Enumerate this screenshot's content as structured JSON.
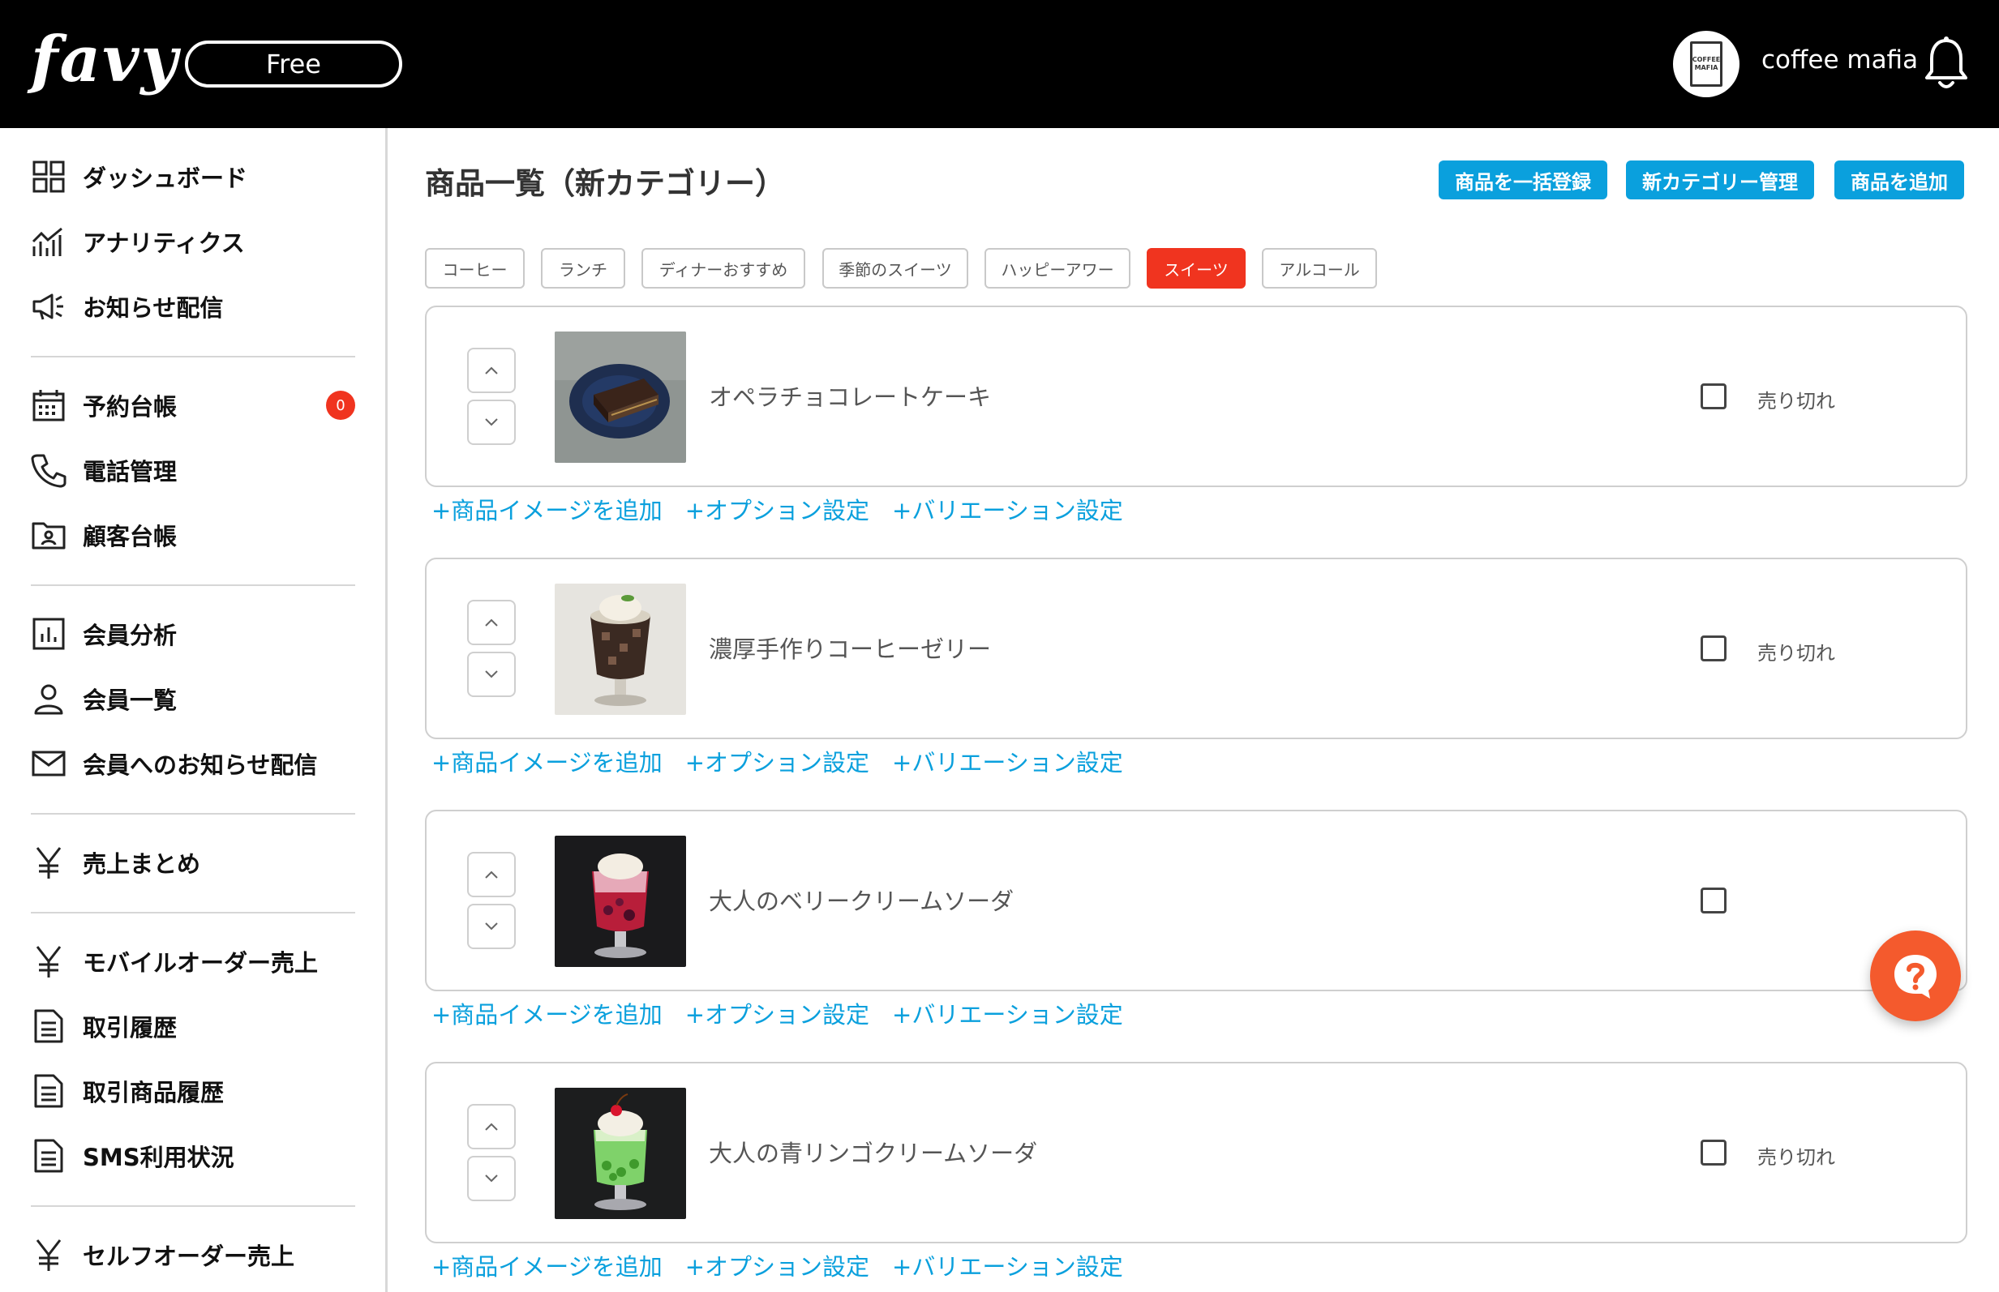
{
  "header": {
    "logo": "favy",
    "plan": "Free",
    "shop_avatar_text": "COFFEE MAFIA",
    "shop_name": "coffee mafia",
    "bell_icon": "bell-icon"
  },
  "sidebar": {
    "items": [
      {
        "label": "ダッシュボード",
        "icon": "dashboard-grid-icon"
      },
      {
        "label": "アナリティクス",
        "icon": "analytics-chart-icon"
      },
      {
        "label": "お知らせ配信",
        "icon": "megaphone-icon"
      },
      {
        "label": "予約台帳",
        "icon": "calendar-icon",
        "badge": "0"
      },
      {
        "label": "電話管理",
        "icon": "phone-icon"
      },
      {
        "label": "顧客台帳",
        "icon": "customer-folder-icon"
      },
      {
        "label": "会員分析",
        "icon": "bar-chart-icon"
      },
      {
        "label": "会員一覧",
        "icon": "user-icon"
      },
      {
        "label": "会員へのお知らせ配信",
        "icon": "mail-icon"
      },
      {
        "label": "売上まとめ",
        "icon": "yen-icon"
      },
      {
        "label": "モバイルオーダー売上",
        "icon": "yen-icon"
      },
      {
        "label": "取引履歴",
        "icon": "document-icon"
      },
      {
        "label": "取引商品履歴",
        "icon": "document-icon"
      },
      {
        "label": "SMS利用状況",
        "icon": "document-icon"
      },
      {
        "label": "セルフオーダー売上",
        "icon": "yen-icon"
      }
    ]
  },
  "main": {
    "title": "商品一覧（新カテゴリー）",
    "actions": {
      "bulk_register": "商品を一括登録",
      "category_manage": "新カテゴリー管理",
      "add_product": "商品を追加"
    },
    "categories": [
      {
        "label": "コーヒー",
        "active": false
      },
      {
        "label": "ランチ",
        "active": false
      },
      {
        "label": "ディナーおすすめ",
        "active": false
      },
      {
        "label": "季節のスイーツ",
        "active": false
      },
      {
        "label": "ハッピーアワー",
        "active": false
      },
      {
        "label": "スイーツ",
        "active": true
      },
      {
        "label": "アルコール",
        "active": false
      }
    ],
    "products": [
      {
        "name": "オペラチョコレートケーキ",
        "soldout_label": "売り切れ",
        "soldout_checked": false
      },
      {
        "name": "濃厚手作りコーヒーゼリー",
        "soldout_label": "売り切れ",
        "soldout_checked": false
      },
      {
        "name": "大人のベリークリームソーダ",
        "soldout_label": "",
        "soldout_checked": false
      },
      {
        "name": "大人の青リンゴクリームソーダ",
        "soldout_label": "売り切れ",
        "soldout_checked": false
      }
    ],
    "product_links": {
      "add_image": "+商品イメージを追加",
      "option": "+オプション設定",
      "variation": "+バリエーション設定"
    }
  },
  "colors": {
    "accent_blue": "#0aa0dd",
    "active_red": "#f0341f",
    "help_orange": "#f45a2d",
    "header_bg": "#000000"
  },
  "help_icon": "help-question-icon"
}
